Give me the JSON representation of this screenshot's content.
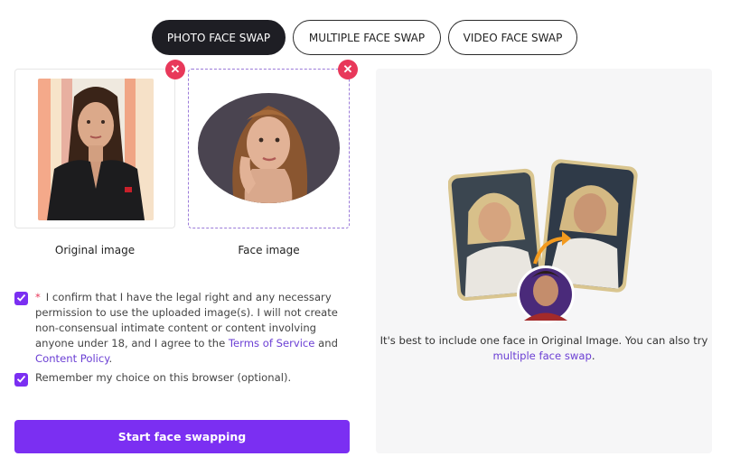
{
  "tabs": [
    {
      "label": "PHOTO FACE SWAP",
      "active": true
    },
    {
      "label": "MULTIPLE FACE SWAP",
      "active": false
    },
    {
      "label": "VIDEO FACE SWAP",
      "active": false
    }
  ],
  "uploads": {
    "original_caption": "Original image",
    "face_caption": "Face image",
    "remove_icon": "close-icon"
  },
  "consent": {
    "required_mark": "*",
    "text_before": "I confirm that I have the legal right and any necessary permission to use the uploaded image(s). I will not create non-consensual intimate content or content involving anyone under 18, and I agree to the ",
    "terms_link": "Terms of Service",
    "and": " and ",
    "policy_link": "Content Policy",
    "period": ".",
    "remember_label": "Remember my choice on this browser (optional).",
    "checked": true
  },
  "start_button": "Start face swapping",
  "hint": {
    "text": "It's best to include one face in Original Image. You can also try",
    "link": "multiple face swap",
    "period": "."
  },
  "colors": {
    "accent": "#7b2ff2",
    "remove": "#e8385a",
    "active_tab": "#1e1e24",
    "panel_bg": "#f6f6f7"
  }
}
